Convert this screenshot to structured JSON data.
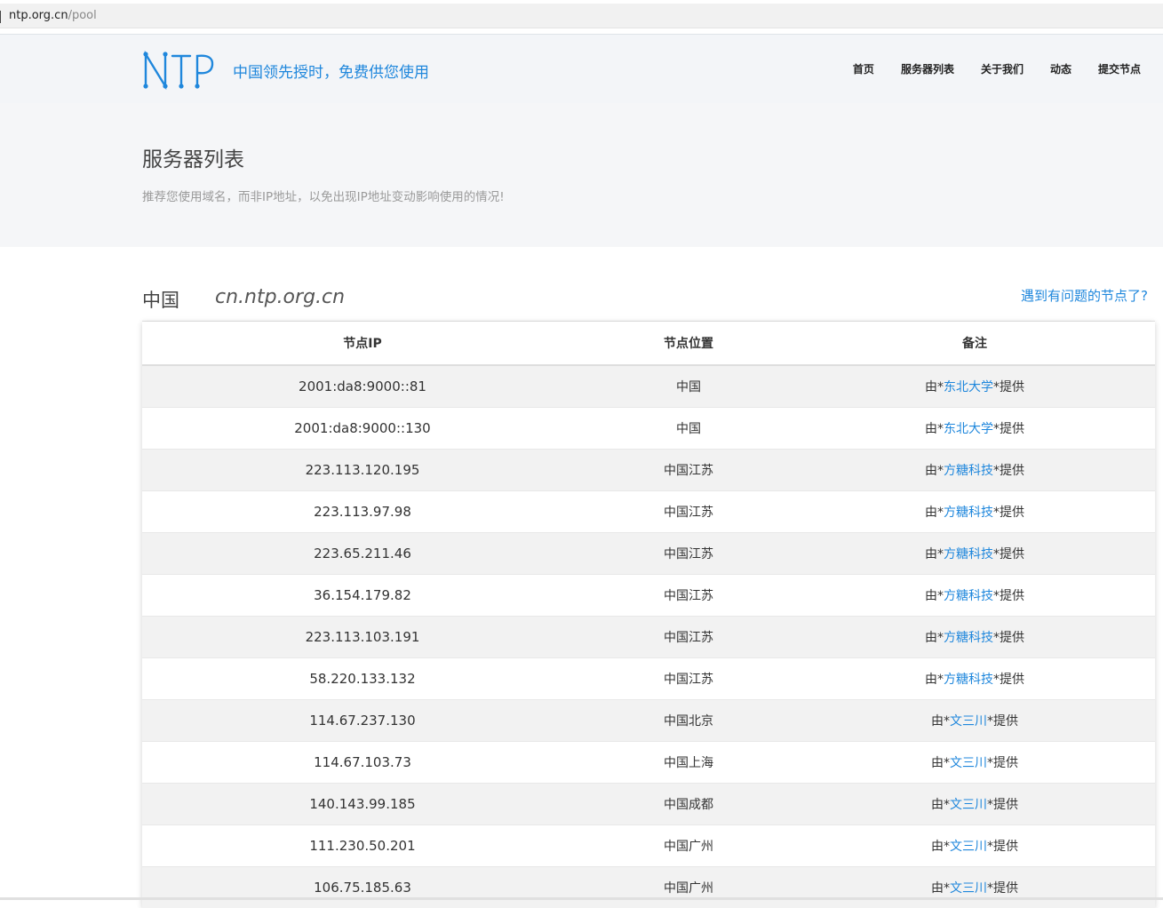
{
  "browser": {
    "url_host": "ntp.org.cn",
    "url_path": "/pool"
  },
  "header": {
    "logo_text": "NTP",
    "slogan": "中国领先授时，免费供您使用",
    "nav": [
      "首页",
      "服务器列表",
      "关于我们",
      "动态",
      "提交节点"
    ]
  },
  "banner": {
    "title": "服务器列表",
    "subtitle": "推荐您使用域名，而非IP地址，以免出现IP地址变动影响使用的情况!"
  },
  "section": {
    "region": "中国",
    "domain": "cn.ntp.org.cn",
    "problem_link": "遇到有问题的节点了?"
  },
  "table": {
    "headers": [
      "节点IP",
      "节点位置",
      "备注"
    ],
    "note_prefix": "由*",
    "note_suffix": "*提供",
    "rows": [
      {
        "ip": "2001:da8:9000::81",
        "location": "中国",
        "provider": "东北大学"
      },
      {
        "ip": "2001:da8:9000::130",
        "location": "中国",
        "provider": "东北大学"
      },
      {
        "ip": "223.113.120.195",
        "location": "中国江苏",
        "provider": "方糖科技"
      },
      {
        "ip": "223.113.97.98",
        "location": "中国江苏",
        "provider": "方糖科技"
      },
      {
        "ip": "223.65.211.46",
        "location": "中国江苏",
        "provider": "方糖科技"
      },
      {
        "ip": "36.154.179.82",
        "location": "中国江苏",
        "provider": "方糖科技"
      },
      {
        "ip": "223.113.103.191",
        "location": "中国江苏",
        "provider": "方糖科技"
      },
      {
        "ip": "58.220.133.132",
        "location": "中国江苏",
        "provider": "方糖科技"
      },
      {
        "ip": "114.67.237.130",
        "location": "中国北京",
        "provider": "文三川"
      },
      {
        "ip": "114.67.103.73",
        "location": "中国上海",
        "provider": "文三川"
      },
      {
        "ip": "140.143.99.185",
        "location": "中国成都",
        "provider": "文三川"
      },
      {
        "ip": "111.230.50.201",
        "location": "中国广州",
        "provider": "文三川"
      },
      {
        "ip": "106.75.185.63",
        "location": "中国广州",
        "provider": "文三川"
      }
    ]
  },
  "colors": {
    "accent": "#1f87dc",
    "header_bg": "#f3f5f8",
    "row_stripe": "#f2f2f2"
  }
}
